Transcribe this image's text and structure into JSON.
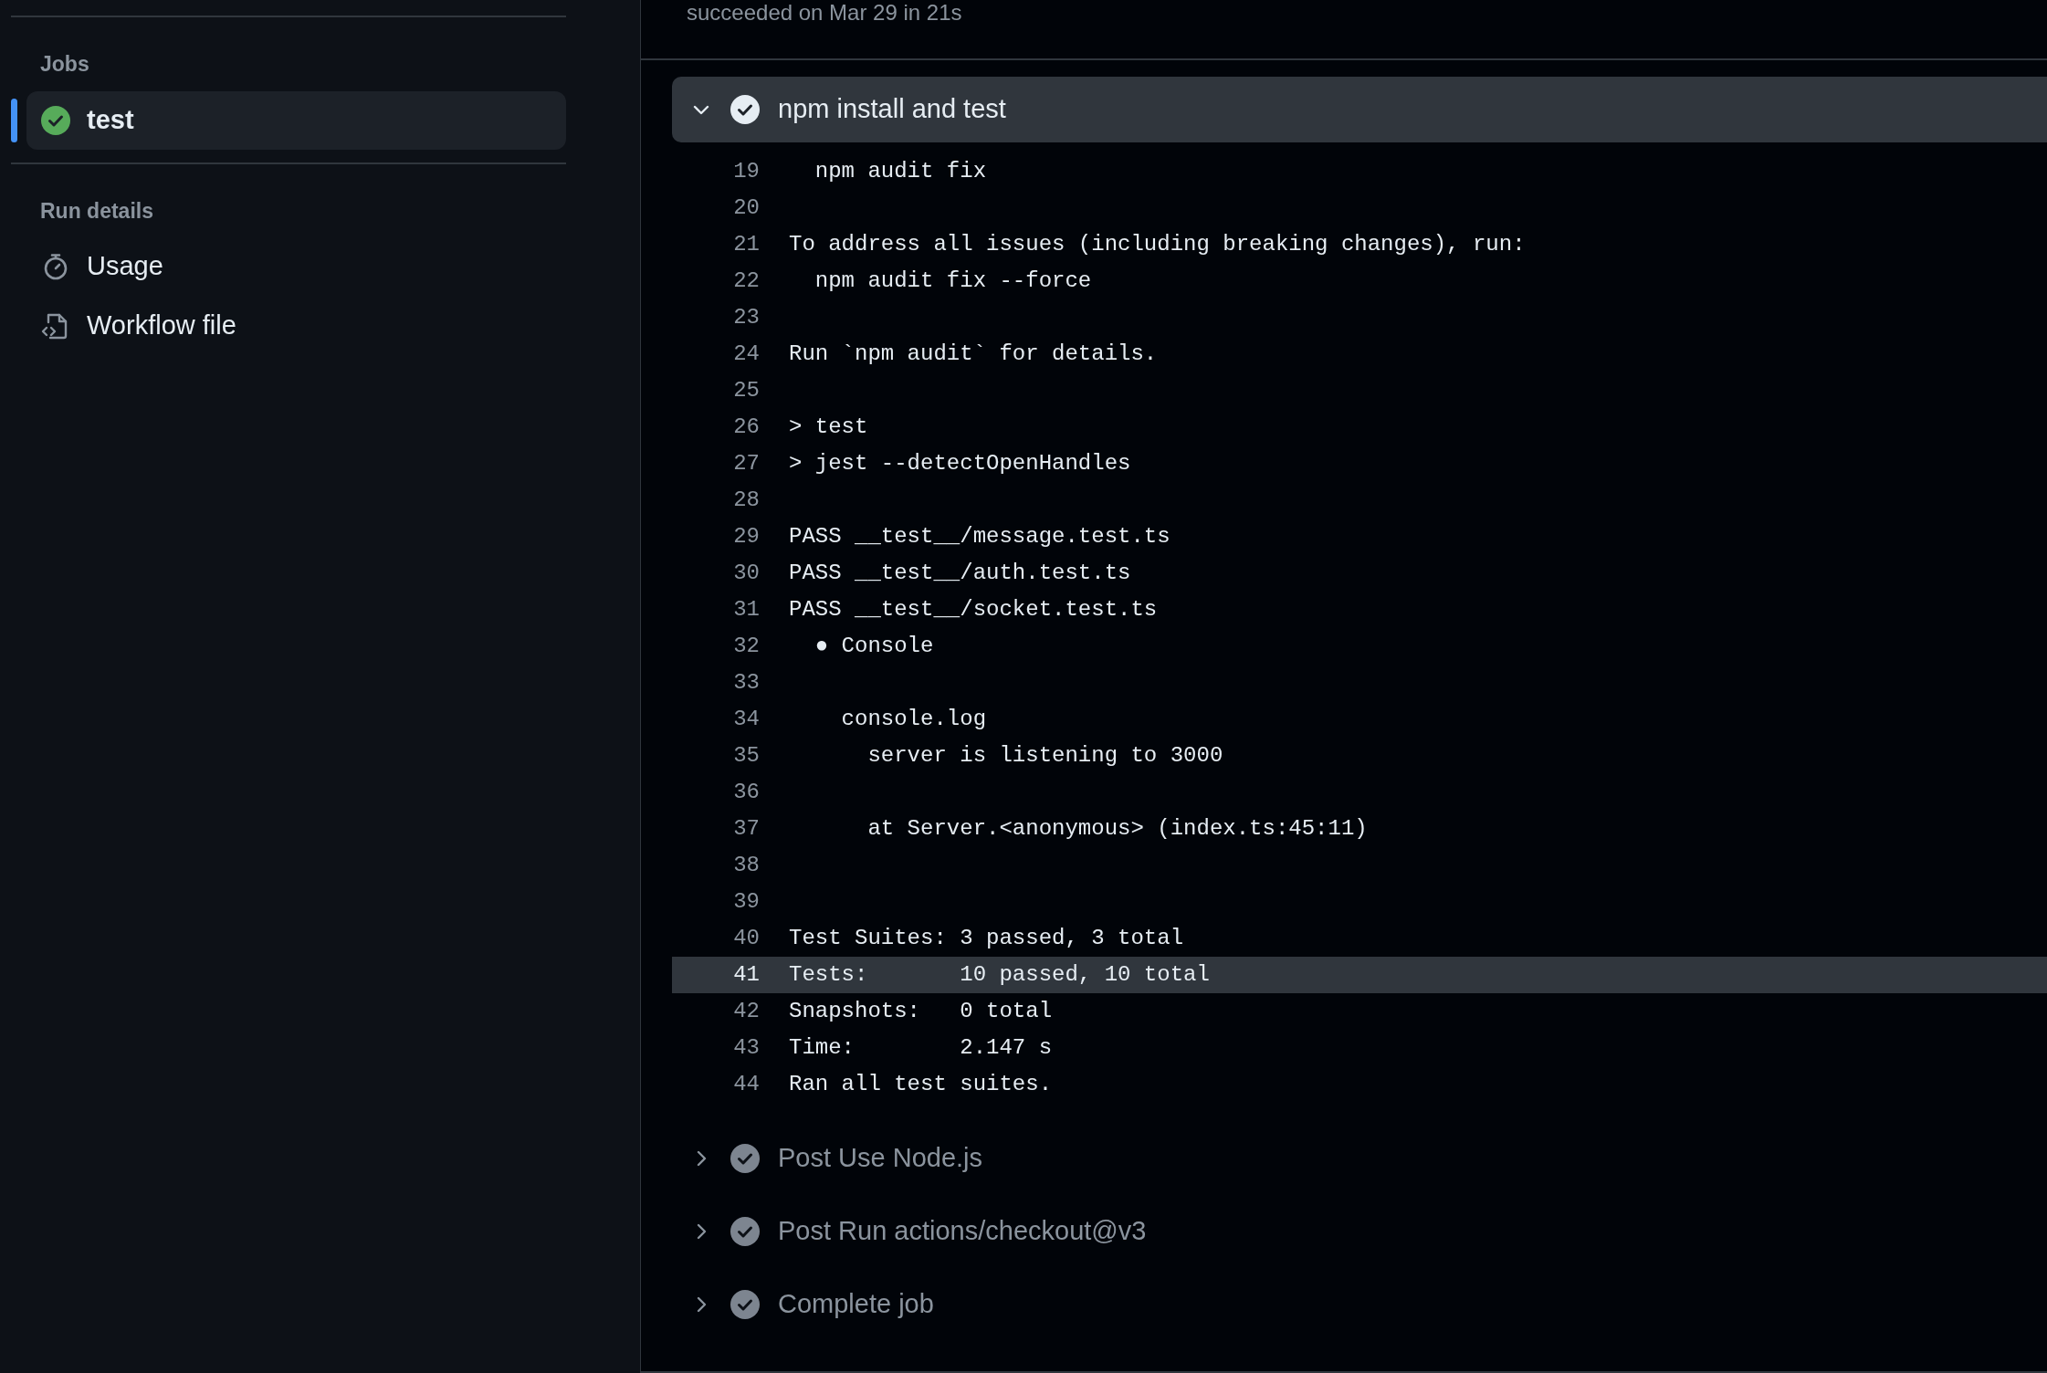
{
  "sidebar": {
    "sections": [
      {
        "heading": "Jobs",
        "items": [
          {
            "kind": "job",
            "label": "test",
            "selected": true
          }
        ]
      },
      {
        "heading": "Run details",
        "items": [
          {
            "kind": "usage",
            "label": "Usage",
            "selected": false
          },
          {
            "kind": "workflow",
            "label": "Workflow file",
            "selected": false
          }
        ]
      }
    ]
  },
  "job_header": {
    "status": "succeeded on Mar 29 in 21s"
  },
  "steps": [
    {
      "name": "npm install and test",
      "expanded": true,
      "log": [
        {
          "number": "19",
          "text": "  npm audit fix",
          "selected": false
        },
        {
          "number": "20",
          "selected": false
        },
        {
          "number": "21",
          "text": "To address all issues (including breaking changes), run:",
          "selected": false
        },
        {
          "number": "22",
          "text": "  npm audit fix --force",
          "selected": false
        },
        {
          "number": "23",
          "selected": false
        },
        {
          "number": "24",
          "text": "Run `npm audit` for details.",
          "selected": false
        },
        {
          "number": "25",
          "selected": false
        },
        {
          "number": "26",
          "text": "> test",
          "selected": false
        },
        {
          "number": "27",
          "text": "> jest --detectOpenHandles",
          "selected": false
        },
        {
          "number": "28",
          "selected": false
        },
        {
          "number": "29",
          "text": "PASS __test__/message.test.ts",
          "selected": false
        },
        {
          "number": "30",
          "text": "PASS __test__/auth.test.ts",
          "selected": false
        },
        {
          "number": "31",
          "text": "PASS __test__/socket.test.ts",
          "selected": false
        },
        {
          "number": "32",
          "text": "  ● Console",
          "selected": false
        },
        {
          "number": "33",
          "selected": false
        },
        {
          "number": "34",
          "text": "    console.log",
          "selected": false
        },
        {
          "number": "35",
          "text": "      server is listening to 3000",
          "selected": false
        },
        {
          "number": "36",
          "selected": false
        },
        {
          "number": "37",
          "text": "      at Server.<anonymous> (index.ts:45:11)",
          "selected": false
        },
        {
          "number": "38",
          "selected": false
        },
        {
          "number": "39",
          "selected": false
        },
        {
          "number": "40",
          "text": "Test Suites: 3 passed, 3 total",
          "selected": false
        },
        {
          "number": "41",
          "text": "Tests:       10 passed, 10 total",
          "selected": true
        },
        {
          "number": "42",
          "text": "Snapshots:   0 total",
          "selected": false
        },
        {
          "number": "43",
          "text": "Time:        2.147 s",
          "selected": false
        },
        {
          "number": "44",
          "text": "Ran all test suites.",
          "selected": false
        }
      ]
    },
    {
      "name": "Post Use Node.js",
      "expanded": false
    },
    {
      "name": "Post Run actions/checkout@v3",
      "expanded": false
    },
    {
      "name": "Complete job",
      "expanded": false
    }
  ]
}
